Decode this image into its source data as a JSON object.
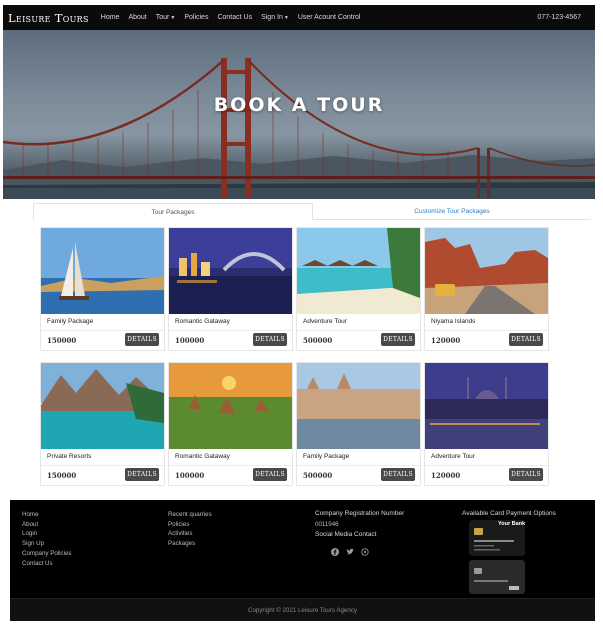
{
  "nav": {
    "brand": "Leisure Tours",
    "items": [
      {
        "label": "Home",
        "dropdown": false
      },
      {
        "label": "About",
        "dropdown": false
      },
      {
        "label": "Tour",
        "dropdown": true
      },
      {
        "label": "Policies",
        "dropdown": false
      },
      {
        "label": "Contact Us",
        "dropdown": false
      },
      {
        "label": "Sign In",
        "dropdown": true
      },
      {
        "label": "User Acount Control",
        "dropdown": false
      }
    ],
    "phone": "077-123-4567"
  },
  "hero": {
    "title": "BOOK A TOUR"
  },
  "tabs": [
    {
      "label": "Tour Packages",
      "active": true
    },
    {
      "label": "Customize Tour Packages",
      "active": false
    }
  ],
  "packages": [
    {
      "title": "Family Package",
      "price": "150000",
      "button": "DETAILS",
      "image": "nile-sailboat"
    },
    {
      "title": "Romantic Gataway",
      "price": "100000",
      "button": "DETAILS",
      "image": "sydney-harbour-night"
    },
    {
      "title": "Adventure Tour",
      "price": "500000",
      "button": "DETAILS",
      "image": "tropical-beach-huts"
    },
    {
      "title": "Niyama Islands",
      "price": "120000",
      "button": "DETAILS",
      "image": "desert-road-van"
    },
    {
      "title": "Private Resorts",
      "price": "150000",
      "button": "DETAILS",
      "image": "mountain-lake"
    },
    {
      "title": "Romantic Gataway",
      "price": "100000",
      "button": "DETAILS",
      "image": "temples-sunset"
    },
    {
      "title": "Family Package",
      "price": "500000",
      "button": "DETAILS",
      "image": "riverside-palace"
    },
    {
      "title": "Adventure Tour",
      "price": "120000",
      "button": "DETAILS",
      "image": "city-mosque-night"
    }
  ],
  "footer": {
    "col1": [
      "Home",
      "About",
      "Login",
      "Sign Up",
      "Company Policies",
      "Contact Us"
    ],
    "col2": [
      "Recent quarries",
      "Policies",
      "Activities",
      "Packages"
    ],
    "registration_heading": "Company Registration Number",
    "registration_number": "0011946",
    "social_heading": "Social Media Contact",
    "social_icons": [
      "facebook-icon",
      "twitter-icon",
      "whatsapp-icon"
    ],
    "payment_heading": "Available Card Payment Options",
    "card_brand": "Your Bank",
    "copyright": "Copyright © 2021 Leisure Tours Agency"
  }
}
